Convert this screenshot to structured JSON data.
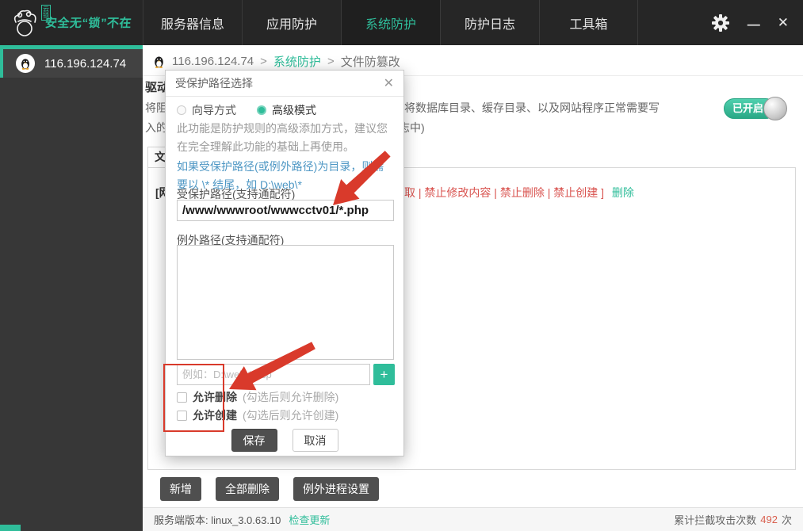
{
  "topbar": {
    "logo_slogan": "安全无“锁”不在",
    "logo_badge": "云锁",
    "tabs": [
      {
        "label": "服务器信息",
        "active": false
      },
      {
        "label": "应用防护",
        "active": false
      },
      {
        "label": "系统防护",
        "active": true
      },
      {
        "label": "防护日志",
        "active": false
      },
      {
        "label": "工具箱",
        "active": false
      }
    ],
    "controls": {
      "minimize": "—",
      "close": "✕"
    }
  },
  "sidebar": {
    "server_ip": "116.196.124.74"
  },
  "breadcrumb": {
    "ip": "116.196.124.74",
    "sep": ">",
    "section": "系统防护",
    "page": "文件防篡改"
  },
  "background": {
    "section_title": "驱动",
    "line1_left": "将阻",
    "line1_right": "议将数据库目录、缓存目录、以及网站程序正常需要写",
    "line2_left": "入的",
    "line2_right": "志中)",
    "toggle_on": "已开启",
    "file_tab": "文件",
    "rule_prefix": "[网",
    "rule_links": "读取 | 禁止修改内容 | 禁止删除 | 禁止创建 ]",
    "rule_delete": "删除",
    "toolbar": {
      "add": "新增",
      "delete_all": "全部删除",
      "exception_process": "例外进程设置"
    }
  },
  "dialog": {
    "title": "受保护路径选择",
    "close": "✕",
    "mode_wizard": "向导方式",
    "mode_advanced": "高级模式",
    "description": "此功能是防护规则的高级添加方式，建议您在完全理解此功能的基础上再使用。",
    "hint": "如果受保护路径(或例外路径)为目录，则需要以 \\* 结尾，如 D:\\web\\*",
    "protected_label": "受保护路径(支持通配符)",
    "protected_value": "/www/wwwroot/wwwcctv01/*.php",
    "exception_label": "例外路径(支持通配符)",
    "add_placeholder": "例如：D:\\web\\*.asp",
    "add_button": "+",
    "allow_delete_label": "允许删除",
    "allow_delete_hint": "(勾选后则允许删除)",
    "allow_create_label": "允许创建",
    "allow_create_hint": "(勾选后则允许创建)",
    "save": "保存",
    "cancel": "取消"
  },
  "statusbar": {
    "version": "服务端版本: linux_3.0.63.10",
    "check_update": "检查更新",
    "counter_label": "累计拦截攻击次数",
    "counter_value": "492",
    "counter_unit": "次"
  },
  "colors": {
    "accent": "#2fbd9a",
    "topbar_bg": "#262626",
    "sidebar_bg": "#373737",
    "annotation_red": "#d93a2b",
    "rule_link_red": "#d9534f",
    "counter_red": "#d9604f"
  }
}
